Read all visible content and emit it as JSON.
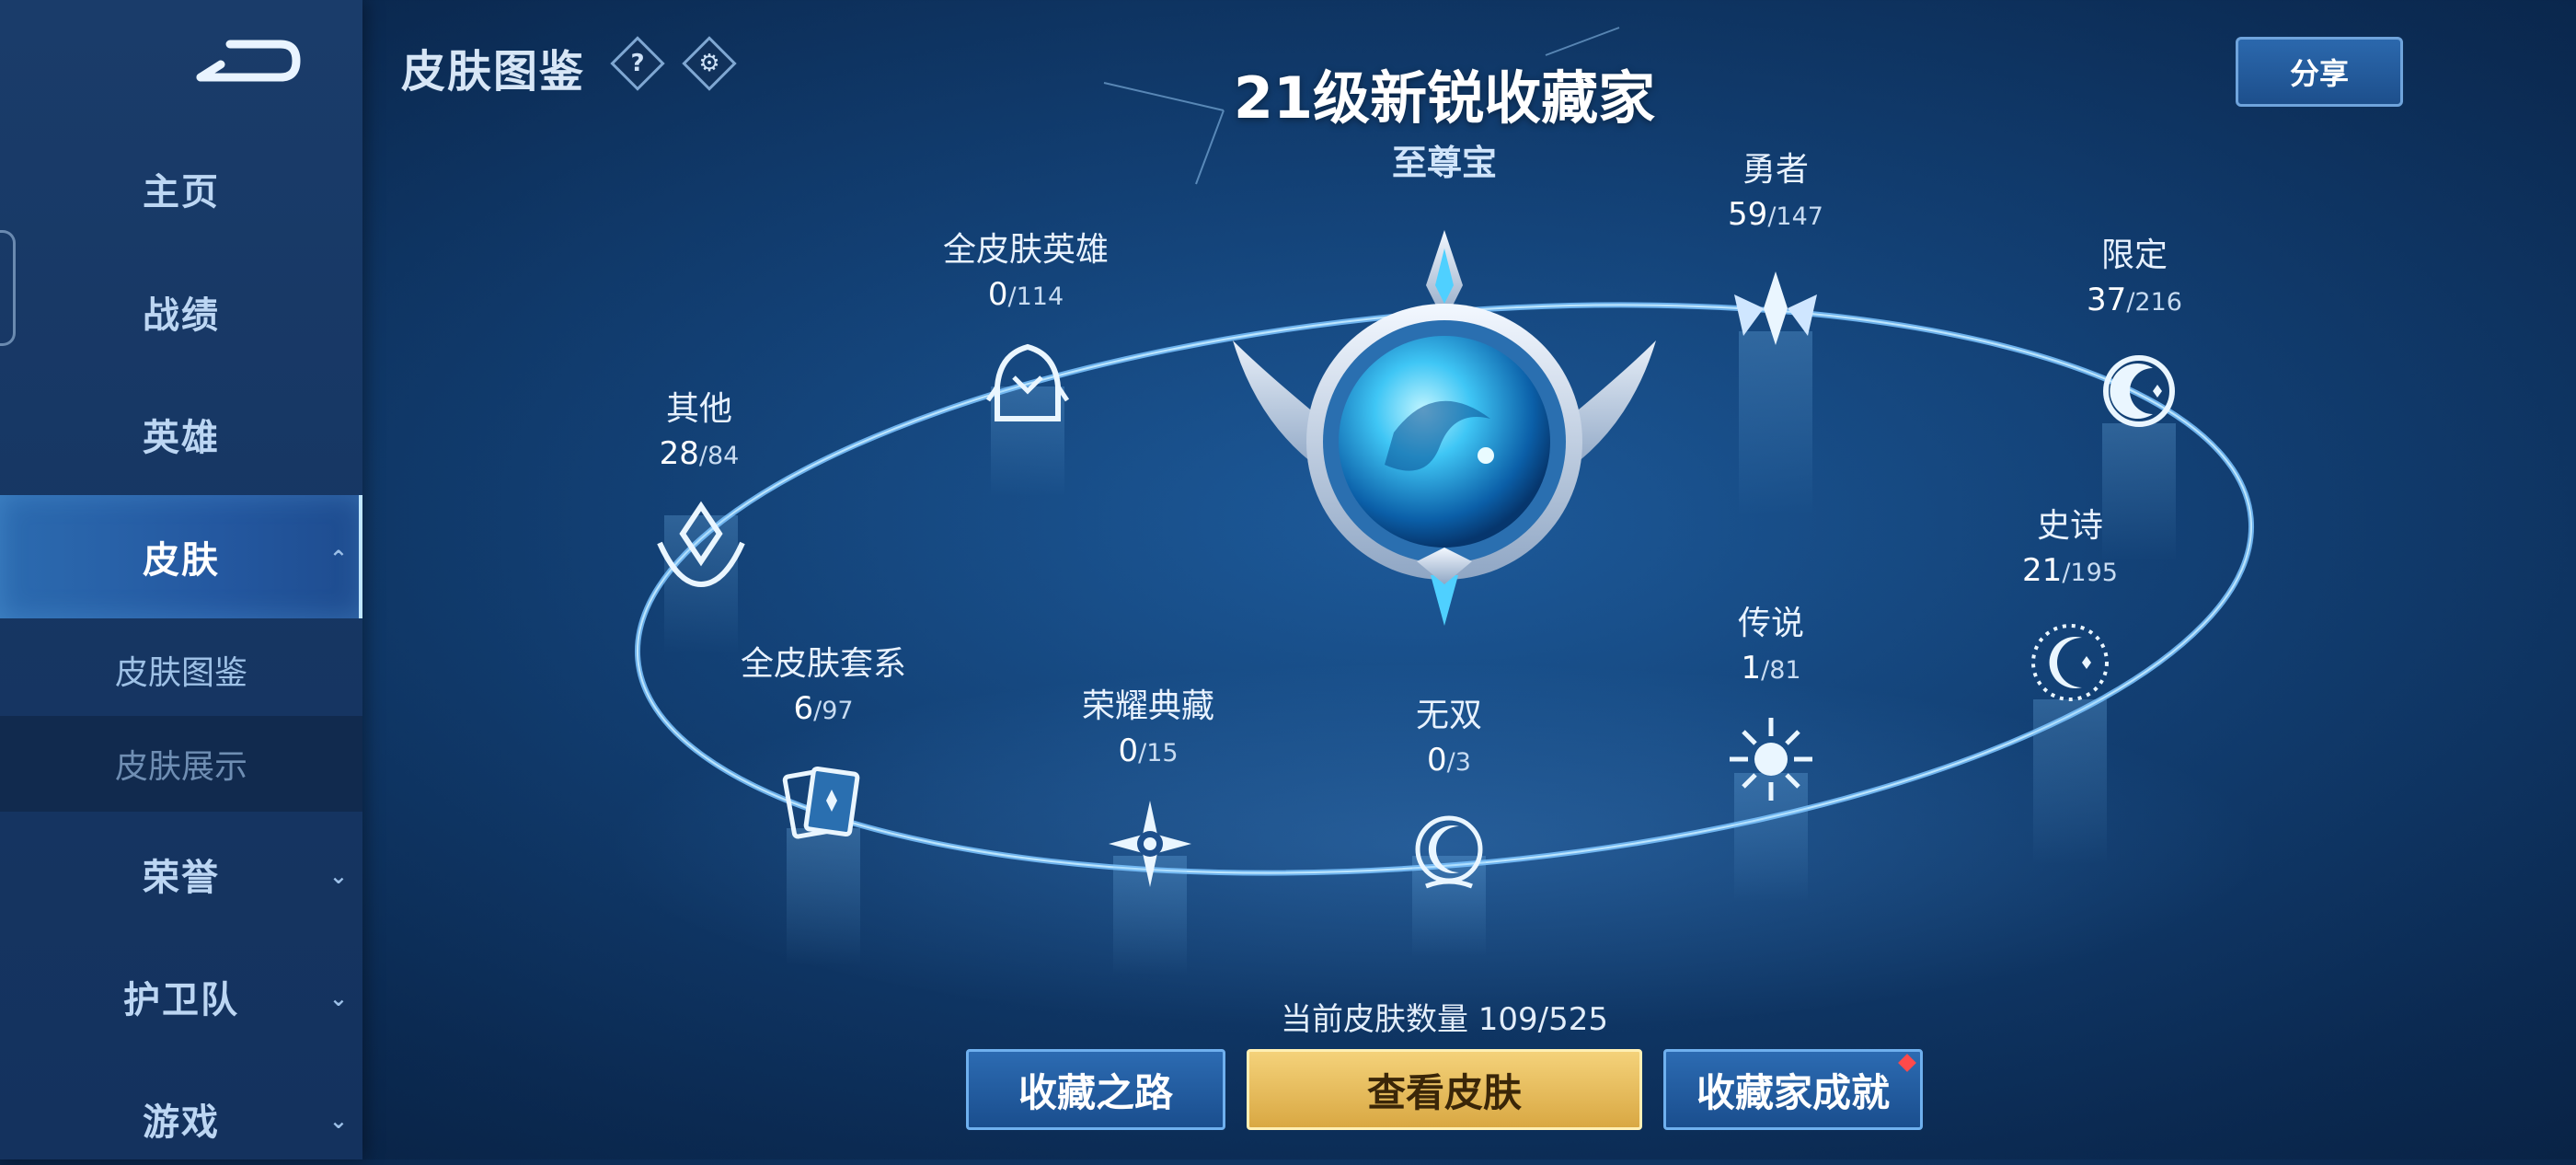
{
  "header": {
    "title": "皮肤图鉴",
    "help_icon": "?",
    "settings_icon": "gear-icon",
    "share_label": "分享"
  },
  "sidebar": {
    "items": [
      {
        "label": "主页"
      },
      {
        "label": "战绩"
      },
      {
        "label": "英雄"
      },
      {
        "label": "皮肤",
        "active": true,
        "chevron": "⌃"
      },
      {
        "label": "皮肤图鉴",
        "sub": true
      },
      {
        "label": "皮肤展示",
        "sub": true
      },
      {
        "label": "荣誉",
        "chevron": "⌄"
      },
      {
        "label": "护卫队",
        "chevron": "⌄"
      },
      {
        "label": "游戏",
        "chevron": "⌄"
      }
    ]
  },
  "collector": {
    "title": "21级新锐收藏家",
    "rank": "至尊宝"
  },
  "categories": [
    {
      "name": "其他",
      "owned": "28",
      "total": "/84"
    },
    {
      "name": "全皮肤英雄",
      "owned": "0",
      "total": "/114"
    },
    {
      "name": "勇者",
      "owned": "59",
      "total": "/147"
    },
    {
      "name": "限定",
      "owned": "37",
      "total": "/216"
    },
    {
      "name": "史诗",
      "owned": "21",
      "total": "/195"
    },
    {
      "name": "传说",
      "owned": "1",
      "total": "/81"
    },
    {
      "name": "无双",
      "owned": "0",
      "total": "/3"
    },
    {
      "name": "荣耀典藏",
      "owned": "0",
      "total": "/15"
    },
    {
      "name": "全皮肤套系",
      "owned": "6",
      "total": "/97"
    }
  ],
  "footer": {
    "count_text": "当前皮肤数量 109/525",
    "buttons": {
      "road": "收藏之路",
      "view": "查看皮肤",
      "achievement": "收藏家成就"
    }
  },
  "colors": {
    "accent_gold": "#e8bd5c",
    "accent_blue": "#2c6bb2",
    "badge_red": "#ff4a4a"
  }
}
